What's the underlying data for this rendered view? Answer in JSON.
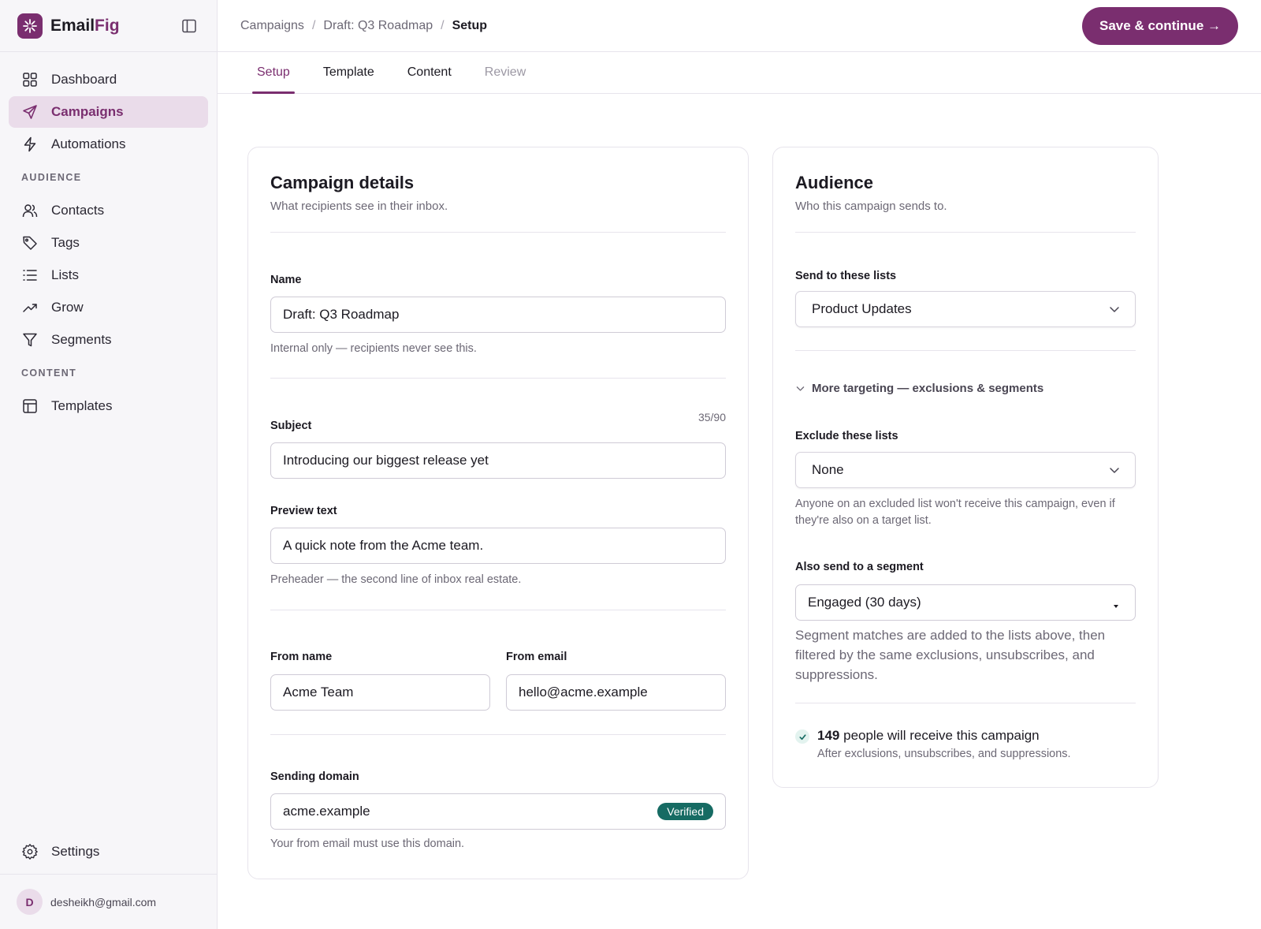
{
  "app": {
    "name_part1": "Email",
    "name_part2": "Fig",
    "brand_color": "#7a2e6f"
  },
  "sidebar": {
    "items_main": [
      {
        "label": "Dashboard",
        "icon": "dashboard-icon"
      },
      {
        "label": "Campaigns",
        "icon": "send-icon",
        "active": true
      },
      {
        "label": "Automations",
        "icon": "bolt-icon"
      }
    ],
    "section_audience": "AUDIENCE",
    "items_audience": [
      {
        "label": "Contacts",
        "icon": "users-icon"
      },
      {
        "label": "Tags",
        "icon": "tag-icon"
      },
      {
        "label": "Lists",
        "icon": "list-icon"
      },
      {
        "label": "Grow",
        "icon": "trending-up-icon"
      },
      {
        "label": "Segments",
        "icon": "filter-icon"
      }
    ],
    "section_content": "CONTENT",
    "items_content": [
      {
        "label": "Templates",
        "icon": "template-icon"
      }
    ],
    "settings_label": "Settings",
    "user": {
      "initial": "D",
      "email": "desheikh@gmail.com"
    }
  },
  "header": {
    "breadcrumb": [
      "Campaigns",
      "Draft: Q3 Roadmap",
      "Setup"
    ],
    "separator": "/",
    "primary_button": "Save & continue →"
  },
  "tabs": [
    {
      "label": "Setup",
      "state": "active"
    },
    {
      "label": "Template",
      "state": "normal"
    },
    {
      "label": "Content",
      "state": "normal"
    },
    {
      "label": "Review",
      "state": "disabled"
    }
  ],
  "details": {
    "title": "Campaign details",
    "subtitle": "What recipients see in their inbox.",
    "name_label": "Name",
    "name_value": "Draft: Q3 Roadmap",
    "name_help": "Internal only — recipients never see this.",
    "subject_label": "Subject",
    "subject_counter": "35/90",
    "subject_value": "Introducing our biggest release yet",
    "preview_label": "Preview text",
    "preview_value": "A quick note from the Acme team.",
    "preview_help": "Preheader — the second line of inbox real estate.",
    "from_name_label": "From name",
    "from_name_value": "Acme Team",
    "from_email_label": "From email",
    "from_email_value": "hello@acme.example",
    "domain_label": "Sending domain",
    "domain_value": "acme.example",
    "domain_badge": "Verified",
    "domain_badge_color": "#166b63",
    "domain_help": "Your from email must use this domain."
  },
  "audience": {
    "title": "Audience",
    "subtitle": "Who this campaign sends to.",
    "send_lists_label": "Send to these lists",
    "send_lists_value": "Product Updates",
    "more_targeting": "More targeting — exclusions & segments",
    "exclude_label": "Exclude these lists",
    "exclude_value": "None",
    "exclude_help": "Anyone on an excluded list won't receive this campaign, even if they're also on a target list.",
    "segment_label": "Also send to a segment",
    "segment_value": "Engaged (30 days)",
    "segment_help": "Segment matches are added to the lists above, then filtered by the same exclusions, unsubscribes, and suppressions.",
    "recipients_count": "149",
    "recipients_text": "people will receive this campaign",
    "recipients_sub": "After exclusions, unsubscribes, and suppressions."
  }
}
